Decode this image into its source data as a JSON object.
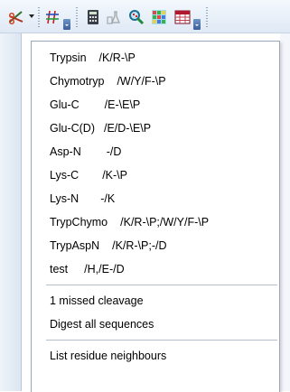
{
  "toolbar": {
    "buttons": [
      {
        "icon": "scissors-digest-icon"
      },
      {
        "icon": "grid-hash-icon"
      },
      {
        "icon": "calculator-icon"
      },
      {
        "icon": "flask-lab-icon"
      },
      {
        "icon": "magnifier-search-icon"
      },
      {
        "icon": "colorful-grid-icon"
      },
      {
        "icon": "calendar-table-icon"
      }
    ],
    "dropdown_arrow_color": "#3a5f99"
  },
  "menu": {
    "enzymes": [
      {
        "label": "Trypsin",
        "pattern": "/K/R-\\P"
      },
      {
        "label": "Chymotryp",
        "pattern": "/W/Y/F-\\P"
      },
      {
        "label": "Glu-C",
        "pattern": "/E-\\E\\P"
      },
      {
        "label": "Glu-C(D)",
        "pattern": "/E/D-\\E\\P"
      },
      {
        "label": "Asp-N",
        "pattern": "-/D"
      },
      {
        "label": "Lys-C",
        "pattern": "/K-\\P"
      },
      {
        "label": "Lys-N",
        "pattern": "-/K"
      },
      {
        "label": "TrypChymo",
        "pattern": "/K/R-\\P;/W/Y/F-\\P"
      },
      {
        "label": "TrypAspN",
        "pattern": "/K/R-\\P;-/D"
      },
      {
        "label": "test",
        "pattern": "/H,/E-/D"
      }
    ],
    "options": [
      {
        "label": "1 missed cleavage"
      },
      {
        "label": "Digest all sequences"
      }
    ],
    "tools": [
      {
        "label": "List residue neighbours"
      }
    ]
  }
}
